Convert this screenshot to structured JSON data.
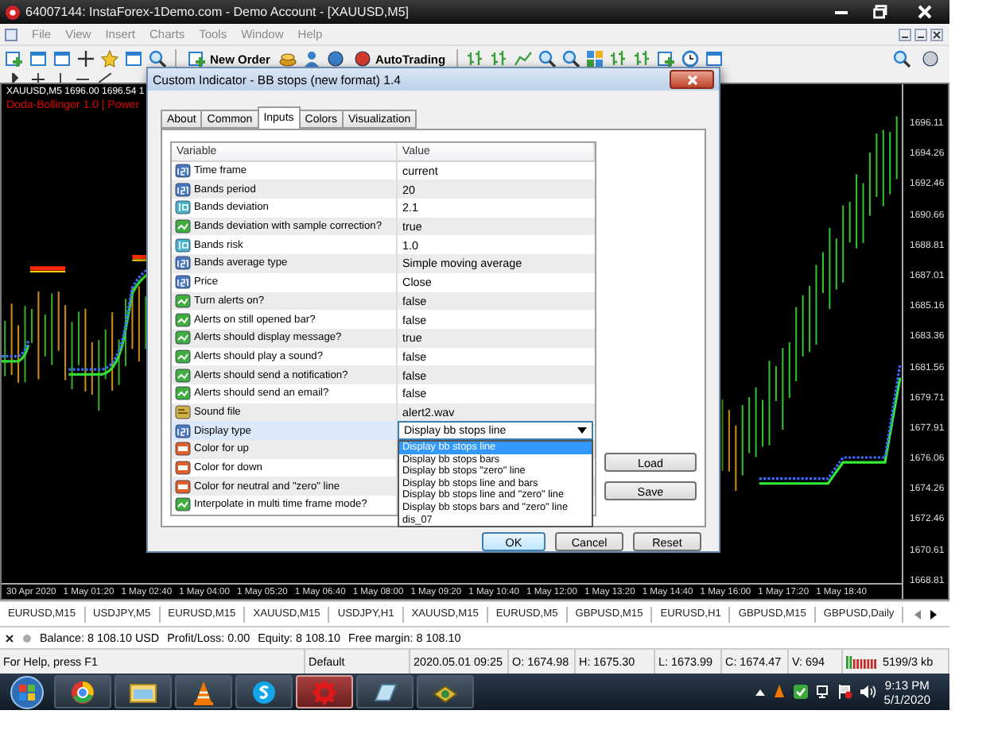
{
  "window": {
    "title": "64007144: InstaForex-1Demo.com - Demo Account - [XAUUSD,M5]",
    "menu": [
      {
        "label": "File",
        "disabled": true
      },
      {
        "label": "View",
        "disabled": true
      },
      {
        "label": "Insert",
        "disabled": true
      },
      {
        "label": "Charts",
        "disabled": true
      },
      {
        "label": "Tools",
        "disabled": true
      },
      {
        "label": "Window",
        "disabled": true
      },
      {
        "label": "Help",
        "disabled": true
      }
    ]
  },
  "toolbar": {
    "buttons": [
      "New Order",
      "AutoTrading"
    ]
  },
  "chart": {
    "header": "XAUUSD,M5  1696.00 1696.54 1",
    "indicator_label": "Doda-Bollinger 1.0 | Power",
    "price_labels": [
      "1696.11",
      "1694.26",
      "1692.46",
      "1690.66",
      "1688.81",
      "1687.01",
      "1685.16",
      "1683.36",
      "1681.56",
      "1679.71",
      "1677.91",
      "1676.06",
      "1674.26",
      "1672.46",
      "1670.61",
      "1668.81"
    ],
    "time_labels": [
      "30 Apr 2020",
      "1 May 01:20",
      "1 May 02:40",
      "1 May 04:00",
      "1 May 05:20",
      "1 May 06:40",
      "1 May 08:00",
      "1 May 09:20",
      "1 May 10:40",
      "1 May 12:00",
      "1 May 13:20",
      "1 May 14:40",
      "1 May 16:00",
      "1 May 17:20",
      "1 May 18:40"
    ]
  },
  "dialog": {
    "title": "Custom Indicator - BB stops (new format) 1.4",
    "tabs": [
      {
        "label": "About",
        "selected": false
      },
      {
        "label": "Common",
        "selected": false
      },
      {
        "label": "Inputs",
        "selected": true
      },
      {
        "label": "Colors",
        "selected": false
      },
      {
        "label": "Visualization",
        "selected": false
      }
    ],
    "columns": [
      "Variable",
      "Value"
    ],
    "rows": [
      {
        "kind": "enum",
        "name": "Time frame",
        "value": "current",
        "selected": false
      },
      {
        "kind": "int",
        "name": "Bands period",
        "value": "20",
        "selected": false
      },
      {
        "kind": "double",
        "name": "Bands deviation",
        "value": "2.1",
        "selected": false
      },
      {
        "kind": "bool",
        "name": "Bands deviation with sample correction?",
        "value": "true",
        "selected": false
      },
      {
        "kind": "double",
        "name": "Bands risk",
        "value": "1.0",
        "selected": false
      },
      {
        "kind": "enum",
        "name": "Bands average type",
        "value": "Simple moving average",
        "selected": false
      },
      {
        "kind": "enum",
        "name": "Price",
        "value": "Close",
        "selected": false
      },
      {
        "kind": "bool",
        "name": "Turn alerts on?",
        "value": "false",
        "selected": false
      },
      {
        "kind": "bool",
        "name": "Alerts on still opened bar?",
        "value": "false",
        "selected": false
      },
      {
        "kind": "bool",
        "name": "Alerts should display message?",
        "value": "true",
        "selected": false
      },
      {
        "kind": "bool",
        "name": "Alerts should play a sound?",
        "value": "false",
        "selected": false
      },
      {
        "kind": "bool",
        "name": "Alerts should send a notification?",
        "value": "false",
        "selected": false
      },
      {
        "kind": "bool",
        "name": "Alerts should send an email?",
        "value": "false",
        "selected": false
      },
      {
        "kind": "string",
        "name": "Sound file",
        "value": "alert2.wav",
        "selected": false
      },
      {
        "kind": "enum",
        "name": "Display type",
        "value": "Display bb stops line",
        "selected": true,
        "expanded": true,
        "options": [
          {
            "label": "Display bb stops line",
            "selected": true
          },
          {
            "label": "Display bb stops bars",
            "selected": false
          },
          {
            "label": "Display bb stops \"zero\" line",
            "selected": false
          },
          {
            "label": "Display bb stops line and bars",
            "selected": false
          },
          {
            "label": "Display bb stops line and \"zero\" line",
            "selected": false
          },
          {
            "label": "Display bb stops bars and \"zero\" line",
            "selected": false
          },
          {
            "label": "dis_07",
            "selected": false
          }
        ]
      },
      {
        "kind": "color",
        "name": "Color for up",
        "selected": false
      },
      {
        "kind": "color",
        "name": "Color for down",
        "selected": false
      },
      {
        "kind": "color",
        "name": "Color for neutral and \"zero\" line",
        "selected": false
      },
      {
        "kind": "bool",
        "name": "Interpolate in multi time frame mode?",
        "selected": false
      }
    ],
    "side_buttons": [
      "Load",
      "Save"
    ],
    "buttons": [
      {
        "label": "OK",
        "default": true
      },
      {
        "label": "Cancel",
        "default": false
      },
      {
        "label": "Reset",
        "default": false
      }
    ]
  },
  "symbol_tabs": [
    "EURUSD,M15",
    "USDJPY,M5",
    "EURUSD,M15",
    "XAUUSD,M15",
    "USDJPY,H1",
    "XAUUSD,M15",
    "EURUSD,M5",
    "GBPUSD,M15",
    "EURUSD,H1",
    "GBPUSD,M15",
    "GBPUSD,Daily"
  ],
  "account": [
    "Balance: 8 108.10 USD",
    "Profit/Loss: 0.00",
    "Equity: 8 108.10",
    "Free margin: 8 108.10"
  ],
  "status_bar": [
    "For Help, press F1",
    "Default",
    "2020.05.01 09:25",
    "O: 1674.98",
    "H: 1675.30",
    "L: 1673.99",
    "C: 1674.47",
    "V: 694",
    "5199/3 kb"
  ],
  "taskbar": {
    "apps": [
      {
        "selected": false
      },
      {
        "selected": false
      },
      {
        "selected": false
      },
      {
        "selected": false
      },
      {
        "selected": true
      },
      {
        "selected": false
      },
      {
        "selected": false
      }
    ],
    "clock_time": "9:13 PM",
    "clock_date": "5/1/2020"
  }
}
